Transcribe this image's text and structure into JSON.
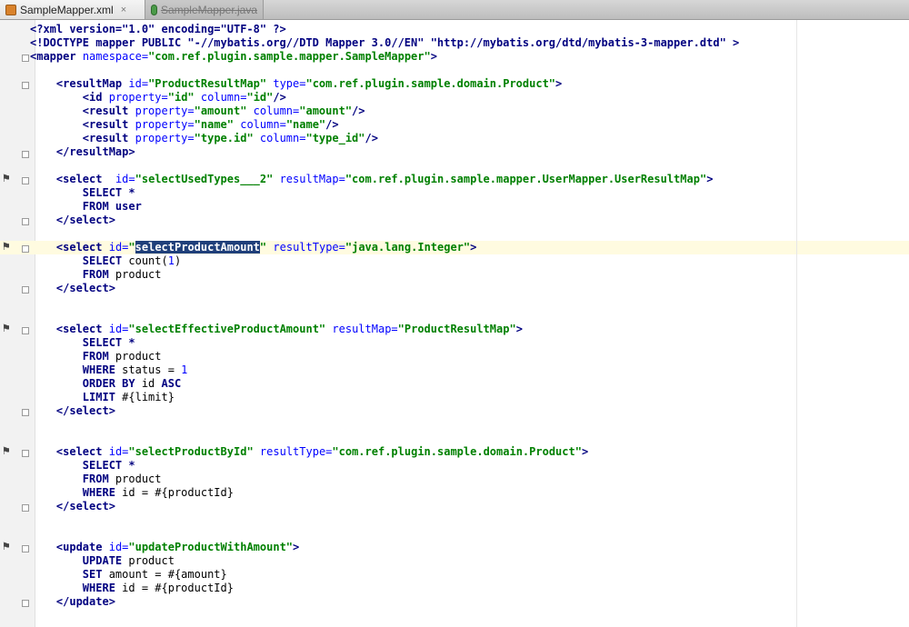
{
  "tabs": [
    {
      "label": "SampleMapper.xml",
      "close": "×",
      "icon": "xml-file-icon"
    },
    {
      "label": "SampleMapper.java",
      "icon": "java-class-icon"
    }
  ],
  "code": {
    "l0": "<?xml version=\"1.0\" encoding=\"UTF-8\" ?>",
    "l1": "<!DOCTYPE mapper PUBLIC \"-//mybatis.org//DTD Mapper 3.0//EN\" \"http://mybatis.org/dtd/mybatis-3-mapper.dtd\" >",
    "l2_tag": "<mapper",
    "l2_attr": "namespace=",
    "l2_val": "\"com.ref.plugin.sample.mapper.SampleMapper\"",
    "l2_end": ">",
    "rm_open": "<resultMap",
    "rm_id": "id=",
    "rm_idv": "\"ProductResultMap\"",
    "rm_type": "type=",
    "rm_typev": "\"com.ref.plugin.sample.domain.Product\"",
    "rm_end": ">",
    "r1_tag": "<id",
    "r1_p": "property=",
    "r1_pv": "\"id\"",
    "r1_c": "column=",
    "r1_cv": "\"id\"",
    "r1_e": "/>",
    "r2_tag": "<result",
    "r2_p": "property=",
    "r2_pv": "\"amount\"",
    "r2_c": "column=",
    "r2_cv": "\"amount\"",
    "r2_e": "/>",
    "r3_tag": "<result",
    "r3_p": "property=",
    "r3_pv": "\"name\"",
    "r3_c": "column=",
    "r3_cv": "\"name\"",
    "r3_e": "/>",
    "r4_tag": "<result",
    "r4_p": "property=",
    "r4_pv": "\"type.id\"",
    "r4_c": "column=",
    "r4_cv": "\"type_id\"",
    "r4_e": "/>",
    "rm_close": "</resultMap>",
    "s1_tag": "<select",
    "s1_id": "id=",
    "s1_idv": "\"selectUsedTypes___2\"",
    "s1_rm": "resultMap=",
    "s1_rmv": "\"com.ref.plugin.sample.mapper.UserMapper.UserResultMap\"",
    "s1_e": ">",
    "s1_l1": "SELECT *",
    "s1_l2k": "FROM",
    "s1_l2t": " user",
    "s1_close": "</select>",
    "s2_tag": "<select",
    "s2_id": "id=",
    "s2_q1": "\"",
    "s2_sel": "selectProductAmount",
    "s2_q2": "\"",
    "s2_rt": "resultType=",
    "s2_rtv": "\"java.lang.Integer\"",
    "s2_e": ">",
    "s2_l1k": "SELECT",
    "s2_l1a": " count(",
    "s2_l1n": "1",
    "s2_l1b": ")",
    "s2_l2k": "FROM",
    "s2_l2t": " product",
    "s2_close": "</select>",
    "s3_tag": "<select",
    "s3_id": "id=",
    "s3_idv": "\"selectEffectiveProductAmount\"",
    "s3_rm": "resultMap=",
    "s3_rmv": "\"ProductResultMap\"",
    "s3_e": ">",
    "s3_l1": "SELECT *",
    "s3_l2k": "FROM",
    "s3_l2t": " product",
    "s3_l3k": "WHERE",
    "s3_l3t": " status = ",
    "s3_l3n": "1",
    "s3_l4k": "ORDER BY",
    "s3_l4t": " id ",
    "s3_l4k2": "ASC",
    "s3_l5k": "LIMIT",
    "s3_l5t": " #{limit}",
    "s3_close": "</select>",
    "s4_tag": "<select",
    "s4_id": "id=",
    "s4_idv": "\"selectProductById\"",
    "s4_rt": "resultType=",
    "s4_rtv": "\"com.ref.plugin.sample.domain.Product\"",
    "s4_e": ">",
    "s4_l1": "SELECT *",
    "s4_l2k": "FROM",
    "s4_l2t": " product",
    "s4_l3k": "WHERE",
    "s4_l3t": " id = #{productId}",
    "s4_close": "</select>",
    "u_tag": "<update",
    "u_id": "id=",
    "u_idv": "\"updateProductWithAmount\"",
    "u_e": ">",
    "u_l1k": "UPDATE",
    "u_l1t": " product",
    "u_l2k": "SET",
    "u_l2t": " amount = #{amount}",
    "u_l3k": "WHERE",
    "u_l3t": " id = #{productId}",
    "u_close": "</update>"
  },
  "gutter_icons": [
    "mapper-statement-icon",
    "mapper-statement-icon",
    "mapper-statement-icon",
    "mapper-statement-icon",
    "mapper-statement-icon"
  ]
}
